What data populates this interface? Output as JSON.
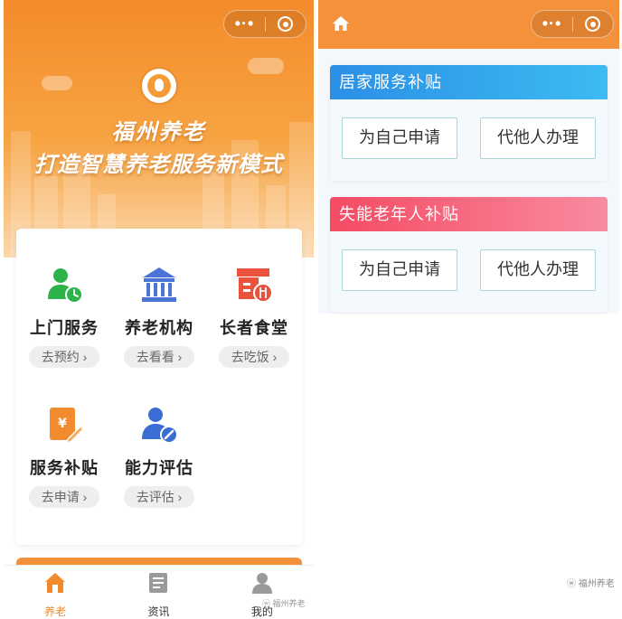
{
  "left_screen": {
    "capsule": {
      "more_icon": "more-dots-icon",
      "close_icon": "target-close-icon"
    },
    "banner": {
      "title": "福州养老",
      "slogan": "打造智慧养老服务新模式"
    },
    "services": [
      {
        "name": "上门服务",
        "action": "去预约",
        "icon": "person-clock-icon",
        "color": "#2cb34a"
      },
      {
        "name": "养老机构",
        "action": "去看看",
        "icon": "institution-building-icon",
        "color": "#4a74d6"
      },
      {
        "name": "长者食堂",
        "action": "去吃饭",
        "icon": "canteen-store-icon",
        "color": "#e9533e"
      },
      {
        "name": "服务补贴",
        "action": "去申请",
        "icon": "subsidy-document-icon",
        "color": "#f28a2e"
      },
      {
        "name": "能力评估",
        "action": "去评估",
        "icon": "assessment-person-icon",
        "color": "#3a6ed4"
      }
    ],
    "tabbar": [
      {
        "label": "养老",
        "icon": "home-icon",
        "active": true
      },
      {
        "label": "资讯",
        "icon": "news-icon",
        "active": false
      },
      {
        "label": "我的",
        "icon": "user-icon",
        "active": false
      }
    ],
    "watermark": "福州养老"
  },
  "right_screen": {
    "panels": [
      {
        "title": "居家服务补贴",
        "buttons": [
          "为自己申请",
          "代他人办理"
        ]
      },
      {
        "title": "失能老年人补贴",
        "buttons": [
          "为自己申请",
          "代他人办理"
        ]
      }
    ],
    "watermark": "福州养老"
  },
  "colors": {
    "brand_orange": "#f4913a",
    "blue_header": "#2b8fe6",
    "red_header": "#f44b63",
    "active_tab": "#f08a2c"
  }
}
